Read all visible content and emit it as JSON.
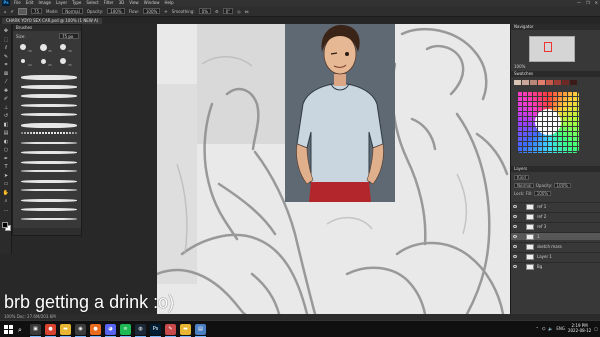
{
  "app": {
    "logo": "Ps",
    "menu": [
      "File",
      "Edit",
      "Image",
      "Layer",
      "Type",
      "Select",
      "Filter",
      "3D",
      "View",
      "Window",
      "Help"
    ],
    "window_controls": [
      "—",
      "❐",
      "✕"
    ]
  },
  "options_bar": {
    "size": "75",
    "mode_label": "Mode:",
    "mode_value": "Normal",
    "opacity_label": "Opacity:",
    "opacity_value": "100%",
    "flow_label": "Flow:",
    "flow_value": "100%",
    "smoothing_label": "Smoothing:",
    "smoothing_value": "0%",
    "angle": "0°"
  },
  "document_tab": {
    "title": "CHARK YOYO SEX CAR.psd @ 100% (1 NEW A)"
  },
  "tools": [
    {
      "icon": "move-icon",
      "glyph": "✥"
    },
    {
      "icon": "marquee-icon",
      "glyph": "⬚"
    },
    {
      "icon": "lasso-icon",
      "glyph": "ℓ"
    },
    {
      "icon": "quick-select-icon",
      "glyph": "✎"
    },
    {
      "icon": "crop-icon",
      "glyph": "⌗"
    },
    {
      "icon": "frame-icon",
      "glyph": "⊠"
    },
    {
      "icon": "eyedropper-icon",
      "glyph": "⁄"
    },
    {
      "icon": "healing-icon",
      "glyph": "✚"
    },
    {
      "icon": "brush-icon",
      "glyph": "✐"
    },
    {
      "icon": "stamp-icon",
      "glyph": "⊥"
    },
    {
      "icon": "history-brush-icon",
      "glyph": "↺"
    },
    {
      "icon": "eraser-icon",
      "glyph": "◧"
    },
    {
      "icon": "gradient-icon",
      "glyph": "▤"
    },
    {
      "icon": "blur-icon",
      "glyph": "◐"
    },
    {
      "icon": "dodge-icon",
      "glyph": "○"
    },
    {
      "icon": "pen-icon",
      "glyph": "✒"
    },
    {
      "icon": "type-icon",
      "glyph": "T"
    },
    {
      "icon": "path-select-icon",
      "glyph": "➤"
    },
    {
      "icon": "shape-icon",
      "glyph": "▭"
    },
    {
      "icon": "hand-icon",
      "glyph": "✋"
    },
    {
      "icon": "zoom-icon",
      "glyph": "⌕"
    },
    {
      "icon": "more-icon",
      "glyph": "…"
    }
  ],
  "brushes_panel": {
    "title": "Brushes",
    "size_label": "Size:",
    "size_value": "75 px",
    "tip_sizes": [
      "30",
      "45",
      "30",
      "20",
      "25",
      "35"
    ]
  },
  "navigator": {
    "title": "Navigator",
    "zoom": "100%"
  },
  "swatches": {
    "title": "Swatches",
    "colors": [
      "#d9c3b3",
      "#c9a79a",
      "#b88777",
      "#e27f6d",
      "#c55a4b",
      "#9b3d35",
      "#6d2a25",
      "#3a1b18"
    ]
  },
  "layers_panel": {
    "title": "Layers",
    "kind_label": "Kind",
    "blend_mode": "Normal",
    "opacity_label": "Opacity:",
    "opacity_value": "100%",
    "lock_label": "Lock:",
    "fill_label": "Fill:",
    "fill_value": "100%",
    "layers": [
      {
        "name": "ref 1",
        "active": false
      },
      {
        "name": "ref 2",
        "active": false
      },
      {
        "name": "ref 3",
        "active": false
      },
      {
        "name": "1",
        "active": true
      },
      {
        "name": "sketch mara",
        "active": false
      },
      {
        "name": "Layer 1",
        "active": false
      },
      {
        "name": "Bg",
        "active": false
      }
    ]
  },
  "status_bar": {
    "text": "100%    Doc: 27.6M/203.6M"
  },
  "overlay": {
    "text": "brb getting a drink :o)"
  },
  "taskbar": {
    "search_icon": "⌕",
    "apps": [
      {
        "name": "task-view",
        "color": "#3a3a3a",
        "glyph": "▣"
      },
      {
        "name": "chrome",
        "color": "#d9432f",
        "glyph": "●"
      },
      {
        "name": "explorer",
        "color": "#e8b533",
        "glyph": "▬"
      },
      {
        "name": "obs",
        "color": "#3c3c3c",
        "glyph": "◉"
      },
      {
        "name": "firefox",
        "color": "#e96b1f",
        "glyph": "●"
      },
      {
        "name": "discord",
        "color": "#5865f2",
        "glyph": "◕"
      },
      {
        "name": "spotify",
        "color": "#1db954",
        "glyph": "≋"
      },
      {
        "name": "steam",
        "color": "#1b2838",
        "glyph": "◍"
      },
      {
        "name": "photoshop",
        "color": "#001e36",
        "glyph": "Ps"
      },
      {
        "name": "clip-studio",
        "color": "#c94a4a",
        "glyph": "✎"
      },
      {
        "name": "folder",
        "color": "#e8b533",
        "glyph": "▬"
      },
      {
        "name": "notepad",
        "color": "#4a7fc1",
        "glyph": "▤"
      }
    ],
    "tray_lang": "ENG",
    "time": "2:19 PM",
    "date": "2022-08-12"
  }
}
